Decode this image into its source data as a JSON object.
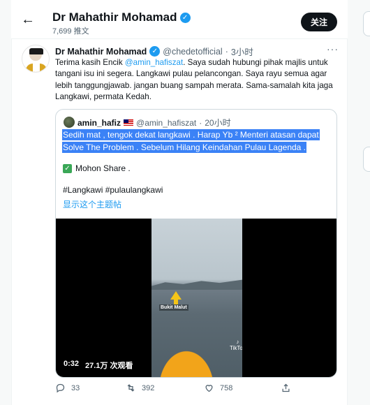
{
  "header": {
    "back_label": "←",
    "name": "Dr Mahathir Mohamad",
    "tweet_count": "7,699 推文",
    "follow_label": "关注"
  },
  "tweet": {
    "name": "Dr Mahathir Mohamad",
    "handle": "@chedetofficial",
    "separator": "·",
    "time": "3小时",
    "more": "···",
    "text_part1": "Terima kasih Encik ",
    "mention": "@amin_hafiszat",
    "text_part2": ".  Saya sudah hubungi pihak majlis untuk tangani isu ini segera. Langkawi pulau pelancongan. Saya rayu semua agar lebih tanggungjawab. jangan buang sampah merata. Sama-samalah kita jaga Langkawi, permata Kedah."
  },
  "quote": {
    "name": "amin_hafiz",
    "handle": "@amin_hafiszat",
    "separator": "·",
    "time": "20小时",
    "line1": "Sedih mat , tengok dekat langkawi . Harap Yb ² Menteri atasan dapat",
    "line2": "Solve The Problem . Sebelum Hilang Keindahan Pulau Lagenda .",
    "share_line": "Mohon Share .",
    "hashtags": "#Langkawi #pulaulangkawi",
    "show_thread": "显示这个主题帖",
    "video": {
      "overlay_label": "Bukit Malut",
      "tiktok_label": "TikTok",
      "duration": "0:32",
      "views": "27.1万 次观看"
    }
  },
  "actions": {
    "replies": "33",
    "retweets": "392",
    "likes": "758"
  },
  "colors": {
    "accent": "#1d9bf0",
    "selection": "#3b82f6",
    "text": "#0f1419",
    "secondary": "#536471"
  }
}
